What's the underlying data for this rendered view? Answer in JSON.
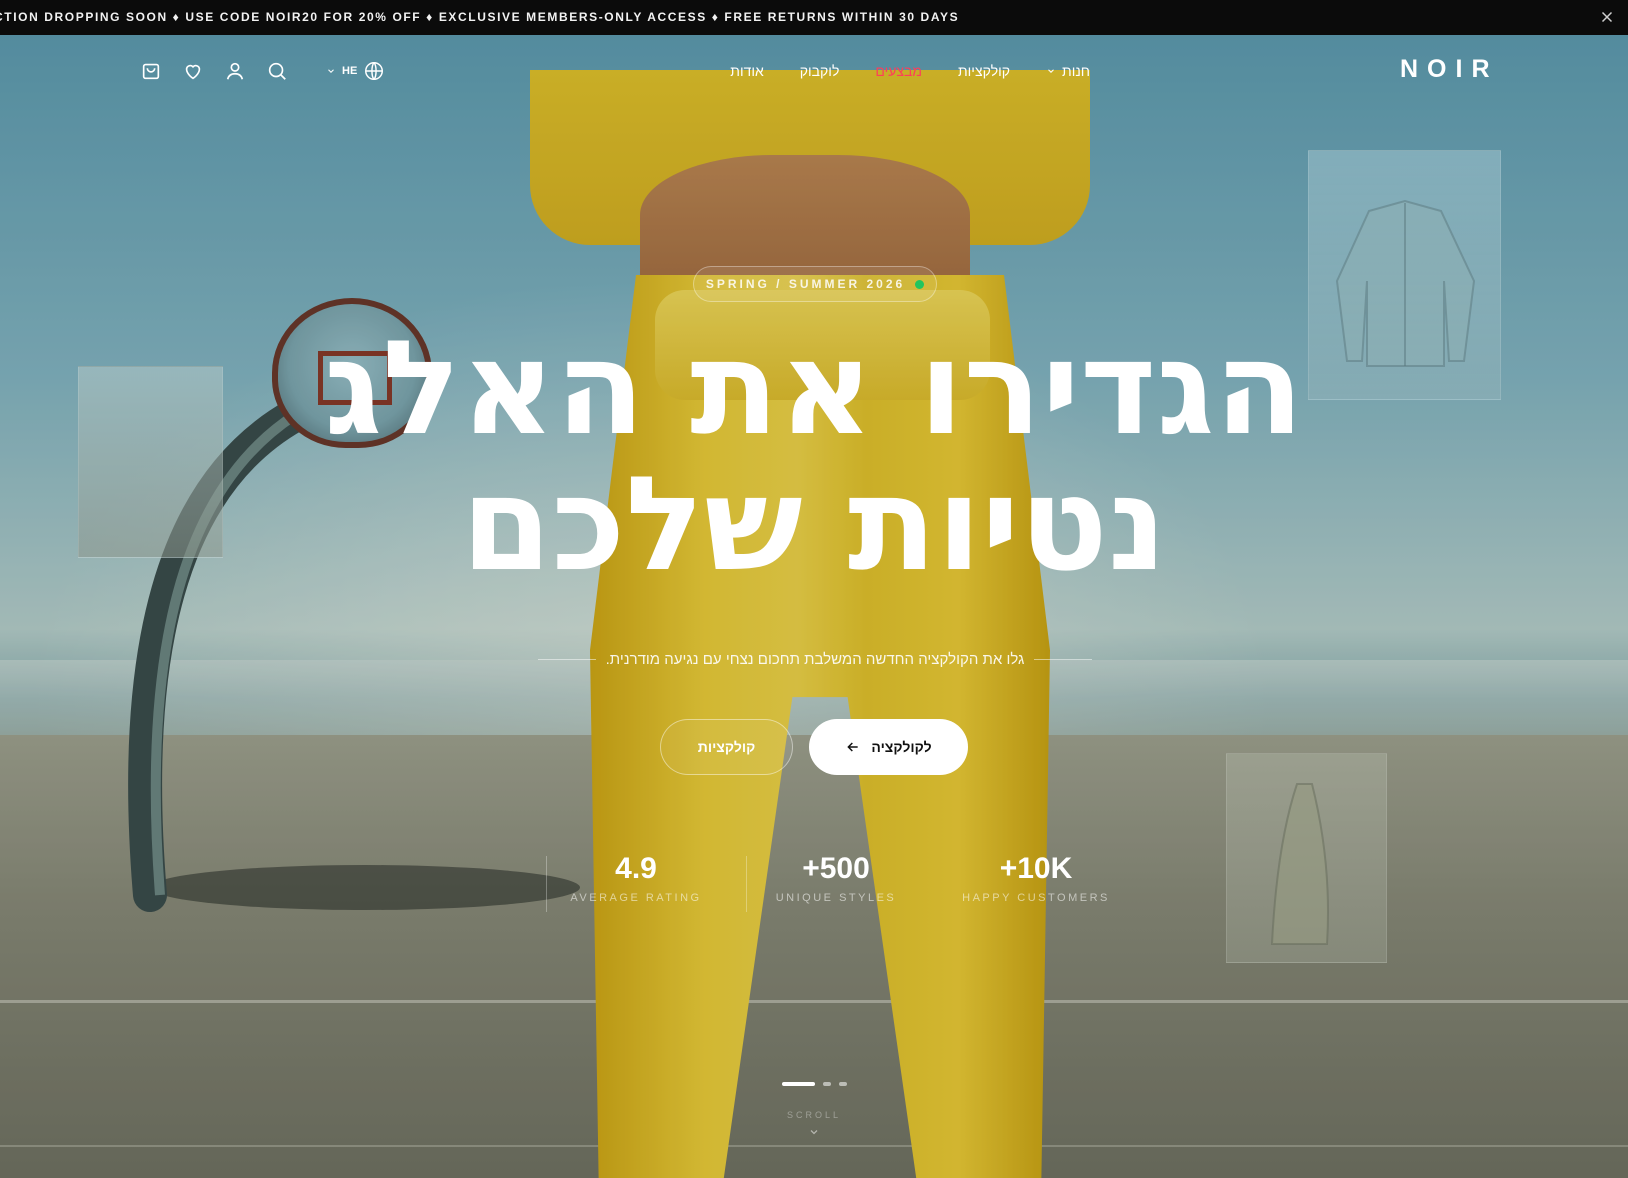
{
  "announcement": {
    "text": "CTION DROPPING SOON ♦ USE CODE NOIR20 FOR 20% OFF ♦ EXCLUSIVE MEMBERS-ONLY ACCESS ♦ FREE RETURNS WITHIN 30 DAYS",
    "close_icon": "close-icon"
  },
  "header": {
    "logo": "NOIR",
    "nav": [
      {
        "label": "חנות",
        "has_dropdown": true
      },
      {
        "label": "קולקציות"
      },
      {
        "label": "מבצעים",
        "highlight": true
      },
      {
        "label": "לוקבוק"
      },
      {
        "label": "אודות"
      }
    ],
    "language": "HE",
    "icons": [
      "cart-icon",
      "heart-icon",
      "user-icon",
      "search-icon",
      "globe-icon"
    ]
  },
  "hero": {
    "badge": "SPRING / SUMMER 2026",
    "headline_line1": "הגדירו את האלג",
    "headline_line2": "נטיות שלכם",
    "subtitle": "גלו את הקולקציה החדשה המשלבת תחכום נצחי עם נגיעה מודרנית.",
    "primary_button": "לקולקציה",
    "secondary_button": "קולקציות",
    "stats": [
      {
        "value": "+10K",
        "label": "HAPPY CUSTOMERS"
      },
      {
        "value": "+500",
        "label": "UNIQUE STYLES"
      },
      {
        "value": "4.9",
        "label": "AVERAGE RATING"
      }
    ],
    "slides": {
      "total": 3,
      "active": 1
    },
    "scroll_label": "SCROLL"
  },
  "colors": {
    "accent_sale": "#ff3d5a",
    "badge_dot": "#22c55e",
    "announcement_bg": "#0b0b0b"
  }
}
